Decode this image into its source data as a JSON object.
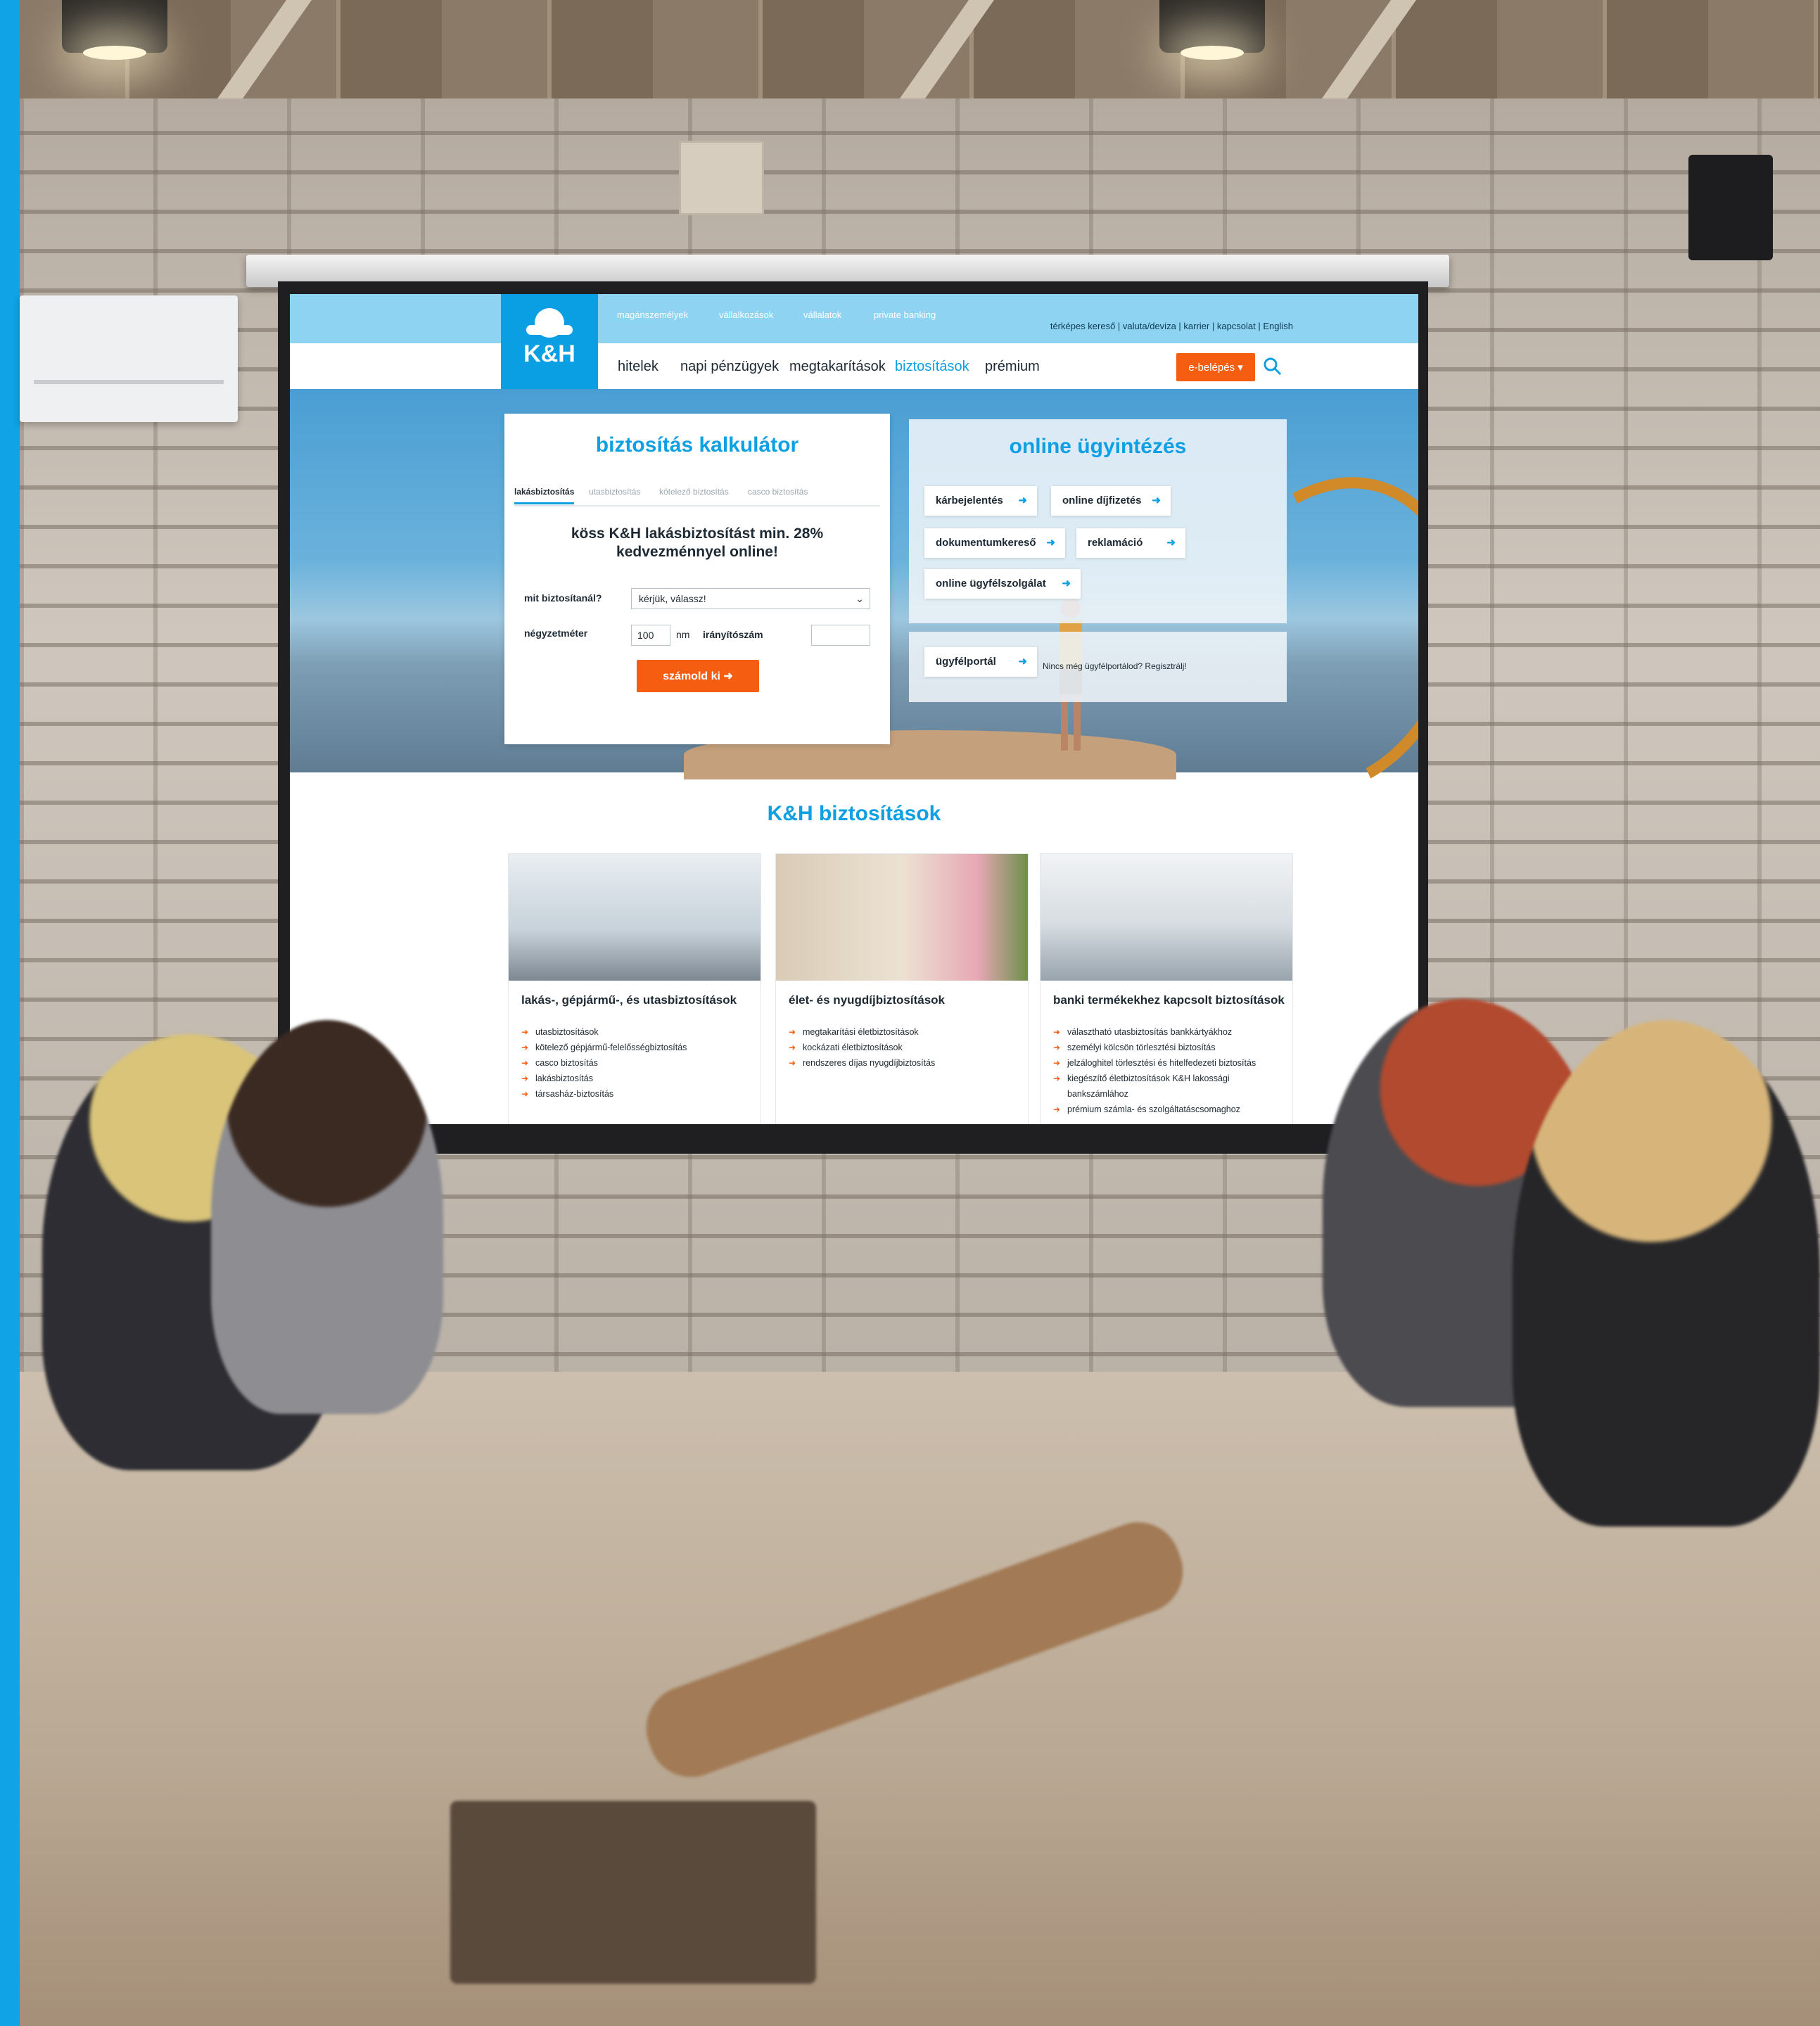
{
  "colors": {
    "brand_blue": "#0ea0e3",
    "brand_orange": "#f55e10",
    "topbar": "#8fd3f3"
  },
  "topbar": {
    "segments": [
      "magánszemélyek",
      "vállalkozások",
      "vállalatok",
      "private banking"
    ],
    "utility_links": "térképes kereső  |  valuta/deviza  |  karrier  |  kapcsolat  |  English"
  },
  "logo": {
    "text": "K&H"
  },
  "nav": {
    "items": [
      "hitelek",
      "napi pénzügyek",
      "megtakarítások",
      "biztosítások",
      "prémium"
    ],
    "active_index": 3,
    "login_label": "e-belépés",
    "search_icon": "search-icon"
  },
  "calculator": {
    "title": "biztosítás kalkulátor",
    "tabs": [
      "lakásbiztosítás",
      "utasbiztosítás",
      "kötelező biztosítás",
      "casco biztosítás"
    ],
    "active_tab": 0,
    "promo": "köss K&H lakásbiztosítást min. 28% kedvezménnyel online!",
    "what_label": "mit biztosítanál?",
    "what_value": "kérjük, válassz!",
    "area_label": "négyzetméter",
    "area_value": "100",
    "area_unit": "nm",
    "zip_label": "irányítószám",
    "zip_value": "",
    "submit_label": "számold ki"
  },
  "online": {
    "title": "online ügyintézés",
    "buttons": [
      "kárbejelentés",
      "online díjfizetés",
      "dokumentumkereső",
      "reklamáció",
      "online ügyfélszolgálat"
    ],
    "portal_label": "ügyfélportál",
    "register_text": "Nincs még ügyfélportálod? Regisztrálj!"
  },
  "products": {
    "title": "K&H biztosítások",
    "cards": [
      {
        "title": "lakás-, gépjármű-, és utasbiztosítások",
        "items": [
          "utasbiztosítások",
          "kötelező gépjármű-felelősségbiztosítás",
          "casco biztosítás",
          "lakásbiztosítás",
          "társasház-biztosítás"
        ]
      },
      {
        "title": "élet- és nyugdíjbiztosítások",
        "items": [
          "megtakarítási életbiztosítások",
          "kockázati életbiztosítások",
          "rendszeres díjas nyugdíjbiztosítás"
        ]
      },
      {
        "title": "banki termékekhez kapcsolt biztosítások",
        "items": [
          "választható utasbiztosítás bankkártyákhoz",
          "személyi kölcsön törlesztési biztosítás",
          "jelzáloghitel törlesztési és hitelfedezeti biztosítás",
          "kiegészítő életbiztosítások K&H lakossági bankszámlához",
          "prémium számla- és szolgáltatáscsomaghoz"
        ]
      }
    ]
  }
}
